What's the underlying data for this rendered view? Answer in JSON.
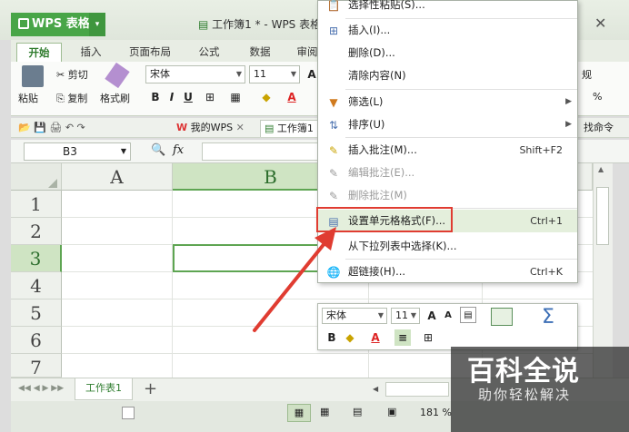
{
  "app": {
    "name": "WPS 表格",
    "doc_title": "工作簿1 * - WPS 表格"
  },
  "tabs": [
    "开始",
    "插入",
    "页面布局",
    "公式",
    "数据",
    "审阅"
  ],
  "ribbon": {
    "paste": "粘贴",
    "cut": "剪切",
    "copy": "复制",
    "format_painter": "格式刷",
    "font": "宋体",
    "size": "11",
    "right_label": "规",
    "percent": "%"
  },
  "qat": {
    "my_wps": "我的WPS",
    "workbook_tab": "工作簿1",
    "find_cmd": "找命令"
  },
  "formula_bar": {
    "name_box": "B3",
    "fx": "fx"
  },
  "grid": {
    "columns": [
      "A",
      "B"
    ],
    "rows": [
      "1",
      "2",
      "3",
      "4",
      "5",
      "6",
      "7"
    ]
  },
  "sheets": {
    "active": "工作表1",
    "add": "+"
  },
  "status": {
    "zoom": "181 %"
  },
  "context_menu": {
    "items": [
      {
        "label": "选择性粘贴(S)...",
        "shortcut": "",
        "disabled": false,
        "icon": "paste-special-icon"
      },
      {
        "label": "插入(I)...",
        "shortcut": "",
        "disabled": false,
        "icon": "insert-icon"
      },
      {
        "label": "删除(D)...",
        "shortcut": "",
        "disabled": false,
        "icon": ""
      },
      {
        "label": "清除内容(N)",
        "shortcut": "",
        "disabled": false,
        "icon": ""
      },
      {
        "label": "筛选(L)",
        "shortcut": "",
        "disabled": false,
        "icon": "filter-icon",
        "submenu": true
      },
      {
        "label": "排序(U)",
        "shortcut": "",
        "disabled": false,
        "icon": "sort-icon",
        "submenu": true
      },
      {
        "label": "插入批注(M)...",
        "shortcut": "Shift+F2",
        "disabled": false,
        "icon": "comment-icon"
      },
      {
        "label": "编辑批注(E)...",
        "shortcut": "",
        "disabled": true,
        "icon": "edit-comment-icon"
      },
      {
        "label": "删除批注(M)",
        "shortcut": "",
        "disabled": true,
        "icon": "delete-comment-icon"
      },
      {
        "label": "设置单元格格式(F)...",
        "shortcut": "Ctrl+1",
        "disabled": false,
        "icon": "format-cells-icon",
        "highlighted": true
      },
      {
        "label": "从下拉列表中选择(K)...",
        "shortcut": "",
        "disabled": false,
        "icon": ""
      },
      {
        "label": "超链接(H)...",
        "shortcut": "Ctrl+K",
        "disabled": false,
        "icon": "hyperlink-icon"
      }
    ]
  },
  "mini_toolbar": {
    "font": "宋体",
    "size": "11",
    "sigma": "Σ"
  },
  "watermark": {
    "line1": "百科全说",
    "line2": "助你轻松解决"
  },
  "colors": {
    "brand_green": "#48a547",
    "highlight_red": "#e03c31",
    "selection_green": "#5ea552"
  }
}
